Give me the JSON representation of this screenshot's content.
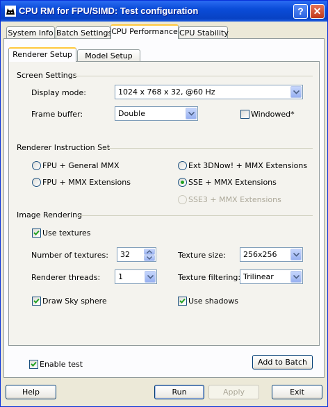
{
  "window": {
    "title": "CPU RM for FPU/SIMD: Test configuration",
    "help_button": "?",
    "close_button": "✕"
  },
  "tabs": [
    {
      "label": "System Info"
    },
    {
      "label": "Batch Settings"
    },
    {
      "label": "CPU Performance",
      "active": true
    },
    {
      "label": "CPU Stability"
    }
  ],
  "subtabs": [
    {
      "label": "Renderer Setup",
      "active": true
    },
    {
      "label": "Model Setup"
    }
  ],
  "screen_settings": {
    "title": "Screen Settings",
    "display_mode_label": "Display mode:",
    "display_mode_value": "1024 x 768 x 32, @60 Hz",
    "frame_buffer_label": "Frame buffer:",
    "frame_buffer_value": "Double",
    "windowed_label": "Windowed*",
    "windowed_checked": false
  },
  "instruction_set": {
    "title": "Renderer Instruction Set",
    "options": [
      {
        "label": "FPU + General MMX",
        "selected": false,
        "enabled": true
      },
      {
        "label": "Ext 3DNow! + MMX Extensions",
        "selected": false,
        "enabled": true
      },
      {
        "label": "FPU + MMX Extensions",
        "selected": false,
        "enabled": true
      },
      {
        "label": "SSE + MMX Extensions",
        "selected": true,
        "enabled": true
      },
      {
        "label": "SSE3 + MMX Extensions",
        "selected": false,
        "enabled": false
      }
    ]
  },
  "image_rendering": {
    "title": "Image Rendering",
    "use_textures_label": "Use textures",
    "use_textures_checked": true,
    "num_textures_label": "Number of textures:",
    "num_textures_value": "32",
    "texture_size_label": "Texture size:",
    "texture_size_value": "256x256",
    "threads_label": "Renderer threads:",
    "threads_value": "1",
    "texture_filtering_label": "Texture filtering:",
    "texture_filtering_value": "Trilinear",
    "sky_label": "Draw Sky sphere",
    "sky_checked": true,
    "shadows_label": "Use shadows",
    "shadows_checked": true
  },
  "footer": {
    "enable_test_label": "Enable test",
    "enable_test_checked": true,
    "add_to_batch": "Add to Batch",
    "help": "Help",
    "run": "Run",
    "apply": "Apply",
    "exit": "Exit"
  },
  "colors": {
    "titlebar": "#0A4CD8",
    "active_tab_highlight": "#FFC83C",
    "radio_dot": "#21A121",
    "check_mark": "#21A121"
  }
}
